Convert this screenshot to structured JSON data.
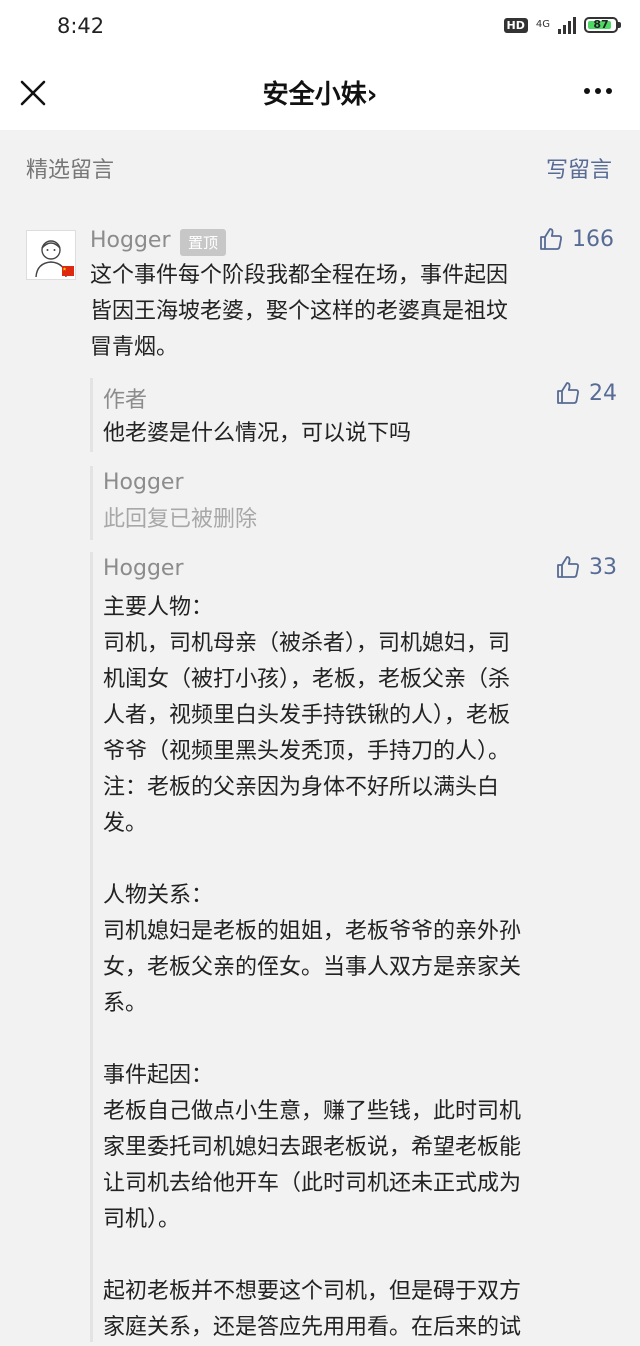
{
  "status_bar": {
    "time": "8:42",
    "hd": "HD",
    "network": "4G",
    "battery": 87
  },
  "nav": {
    "title": "安全小妹",
    "chevron": "›"
  },
  "section": {
    "title": "精选留言",
    "write": "写留言"
  },
  "comment": {
    "author": "Hogger",
    "badge": "置顶",
    "likes": "166",
    "text_lines": [
      "这个事件每个阶段我都全程在场，事件起因",
      "皆因王海坡老婆，娶个这样的老婆真是祖坟",
      "冒青烟。"
    ]
  },
  "reply1": {
    "author": "作者",
    "likes": "24",
    "text": "他老婆是什么情况，可以说下吗"
  },
  "reply2": {
    "author": "Hogger",
    "text": "此回复已被删除"
  },
  "reply3": {
    "author": "Hogger",
    "likes": "33",
    "lines": [
      "主要人物：",
      "司机，司机母亲（被杀者），司机媳妇，司",
      "机闺女（被打小孩），老板，老板父亲（杀",
      "人者，视频里白头发手持铁锹的人），老板",
      "爷爷（视频里黑头发秃顶，手持刀的人）。",
      "注：老板的父亲因为身体不好所以满头白",
      "发。",
      "",
      "人物关系：",
      "司机媳妇是老板的姐姐，老板爷爷的亲外孙",
      "女，老板父亲的侄女。当事人双方是亲家关",
      "系。",
      "",
      "事件起因：",
      "老板自己做点小生意，赚了些钱，此时司机",
      "家里委托司机媳妇去跟老板说，希望老板能",
      "让司机去给他开车（此时司机还未正式成为",
      "司机）。",
      "",
      "起初老板并不想要这个司机，但是碍于双方",
      "家庭关系，还是答应先用用看。在后来的试"
    ]
  },
  "icons": {
    "close": "close-icon",
    "more": "more-icon",
    "thumb": "thumb-up-icon",
    "avatar": "avatar",
    "flag": "china-flag-icon"
  },
  "colors": {
    "link": "#576b95",
    "battery": "#4cd964",
    "background": "#f2f2f2"
  }
}
